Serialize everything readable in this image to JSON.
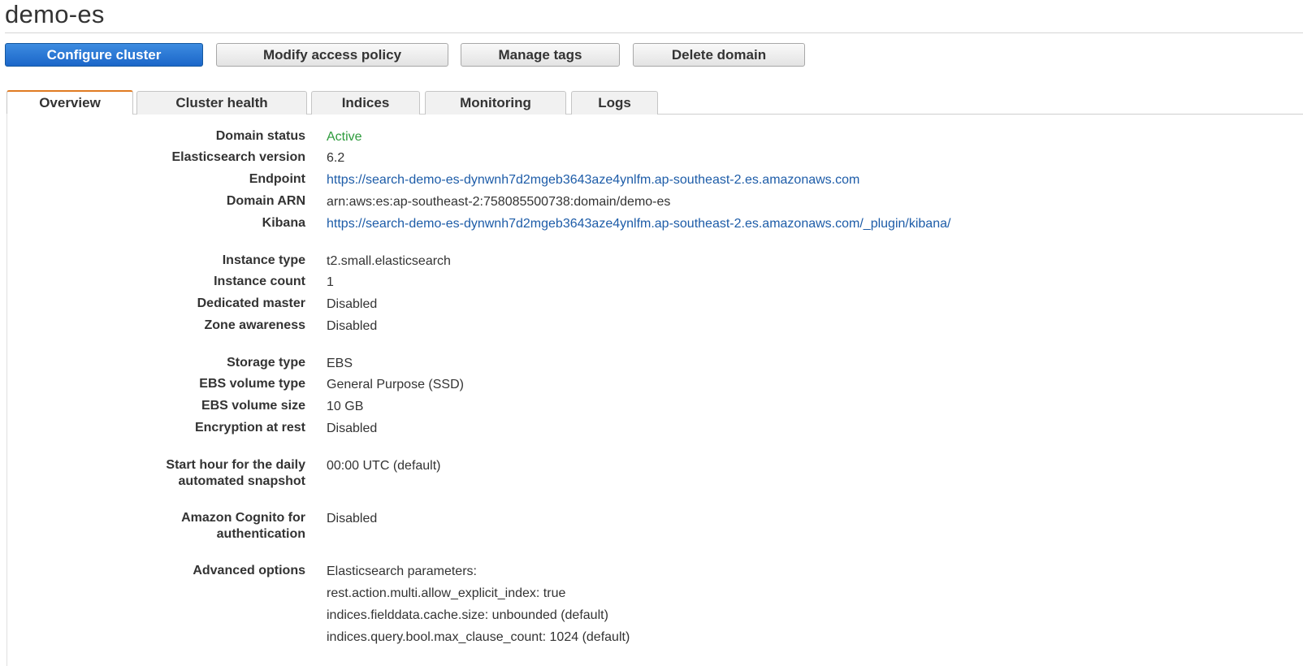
{
  "page": {
    "title": "demo-es"
  },
  "actions": {
    "configure_cluster": "Configure cluster",
    "modify_access_policy": "Modify access policy",
    "manage_tags": "Manage tags",
    "delete_domain": "Delete domain"
  },
  "tabs": {
    "overview": "Overview",
    "cluster_health": "Cluster health",
    "indices": "Indices",
    "monitoring": "Monitoring",
    "logs": "Logs",
    "active": "Overview"
  },
  "details": {
    "domain_status": {
      "label": "Domain status",
      "value": "Active"
    },
    "es_version": {
      "label": "Elasticsearch version",
      "value": "6.2"
    },
    "endpoint": {
      "label": "Endpoint",
      "value": "https://search-demo-es-dynwnh7d2mgeb3643aze4ynlfm.ap-southeast-2.es.amazonaws.com"
    },
    "domain_arn": {
      "label": "Domain ARN",
      "value": "arn:aws:es:ap-southeast-2:758085500738:domain/demo-es"
    },
    "kibana": {
      "label": "Kibana",
      "value": "https://search-demo-es-dynwnh7d2mgeb3643aze4ynlfm.ap-southeast-2.es.amazonaws.com/_plugin/kibana/"
    },
    "instance_type": {
      "label": "Instance type",
      "value": "t2.small.elasticsearch"
    },
    "instance_count": {
      "label": "Instance count",
      "value": "1"
    },
    "dedicated_master": {
      "label": "Dedicated master",
      "value": "Disabled"
    },
    "zone_awareness": {
      "label": "Zone awareness",
      "value": "Disabled"
    },
    "storage_type": {
      "label": "Storage type",
      "value": "EBS"
    },
    "ebs_volume_type": {
      "label": "EBS volume type",
      "value": "General Purpose (SSD)"
    },
    "ebs_volume_size": {
      "label": "EBS volume size",
      "value": "10 GB"
    },
    "encryption_at_rest": {
      "label": "Encryption at rest",
      "value": "Disabled"
    },
    "snapshot_hour": {
      "label_line1": "Start hour for the daily",
      "label_line2": "automated snapshot",
      "value": "00:00 UTC (default)"
    },
    "cognito": {
      "label_line1": "Amazon Cognito for",
      "label_line2": "authentication",
      "value": "Disabled"
    },
    "advanced_options": {
      "label": "Advanced options",
      "heading": "Elasticsearch parameters:",
      "params": [
        "rest.action.multi.allow_explicit_index: true",
        "indices.fielddata.cache.size: unbounded (default)",
        "indices.query.bool.max_clause_count: 1024 (default)"
      ]
    }
  },
  "colors": {
    "accent": "#1b66c9",
    "active_status": "#2d9b3c",
    "link": "#1d5ca8",
    "tab_active_border": "#e07b23"
  }
}
